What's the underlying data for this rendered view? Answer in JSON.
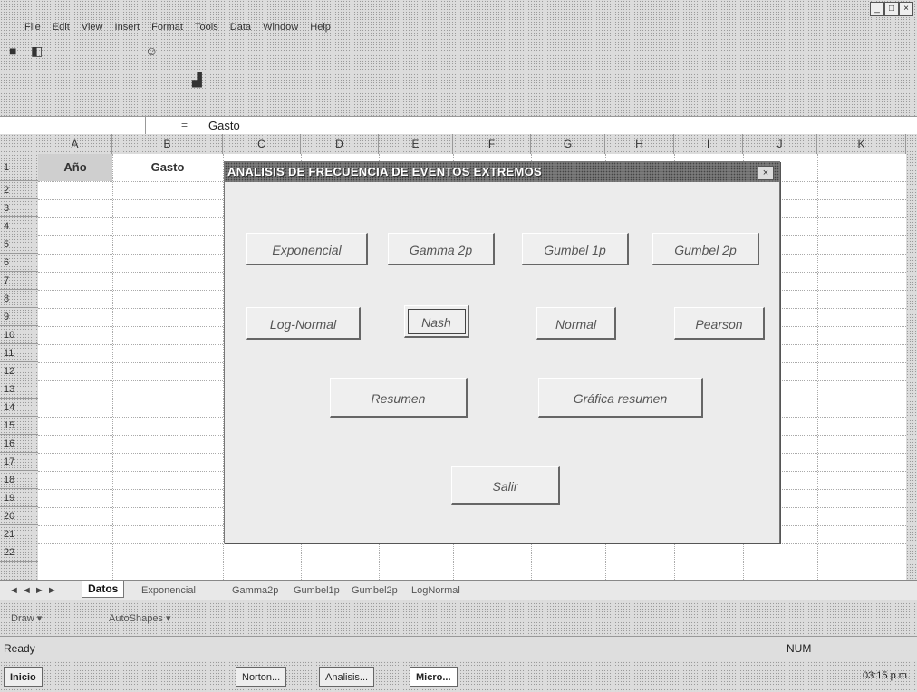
{
  "menu": [
    "File",
    "Edit",
    "View",
    "Insert",
    "Format",
    "Tools",
    "Data",
    "Window",
    "Help"
  ],
  "formula_bar": {
    "fx": "=",
    "content": "Gasto"
  },
  "columns": [
    "A",
    "B",
    "C",
    "D",
    "E",
    "F",
    "G",
    "H",
    "I",
    "J",
    "K"
  ],
  "rows": [
    "1",
    "2",
    "3",
    "4",
    "5",
    "6",
    "7",
    "8",
    "9",
    "10",
    "11",
    "12",
    "13",
    "14",
    "15",
    "16",
    "17",
    "18",
    "19",
    "20",
    "21",
    "22"
  ],
  "cells": {
    "a1": "Año",
    "b1": "Gasto"
  },
  "dialog": {
    "title": "ANALISIS DE FRECUENCIA DE EVENTOS  EXTREMOS",
    "close": "×",
    "buttons": {
      "exponencial": "Exponencial",
      "gamma2p": "Gamma 2p",
      "gumbel1p": "Gumbel 1p",
      "gumbel2p": "Gumbel 2p",
      "lognormal": "Log-Normal",
      "nash": "Nash",
      "normal": "Normal",
      "pearson": "Pearson",
      "resumen": "Resumen",
      "grafica": "Gráfica resumen",
      "salir": "Salir"
    }
  },
  "sheet_tabs": [
    "Datos",
    "Exponencial",
    "Gamma2p",
    "Gumbel1p",
    "Gumbel2p",
    "LogNormal"
  ],
  "drawing": {
    "draw": "Draw ▾",
    "autoshapes": "AutoShapes ▾"
  },
  "status": {
    "ready": "Ready",
    "num": "NUM"
  },
  "taskbar": {
    "start": "Inicio",
    "task1": "Norton...",
    "task2": "Analisis...",
    "task3": "Micro...",
    "clock": "03:15 p.m."
  },
  "icons": [
    "save-icon",
    "print-preview-icon",
    "smiley-icon",
    "chart-icon"
  ]
}
